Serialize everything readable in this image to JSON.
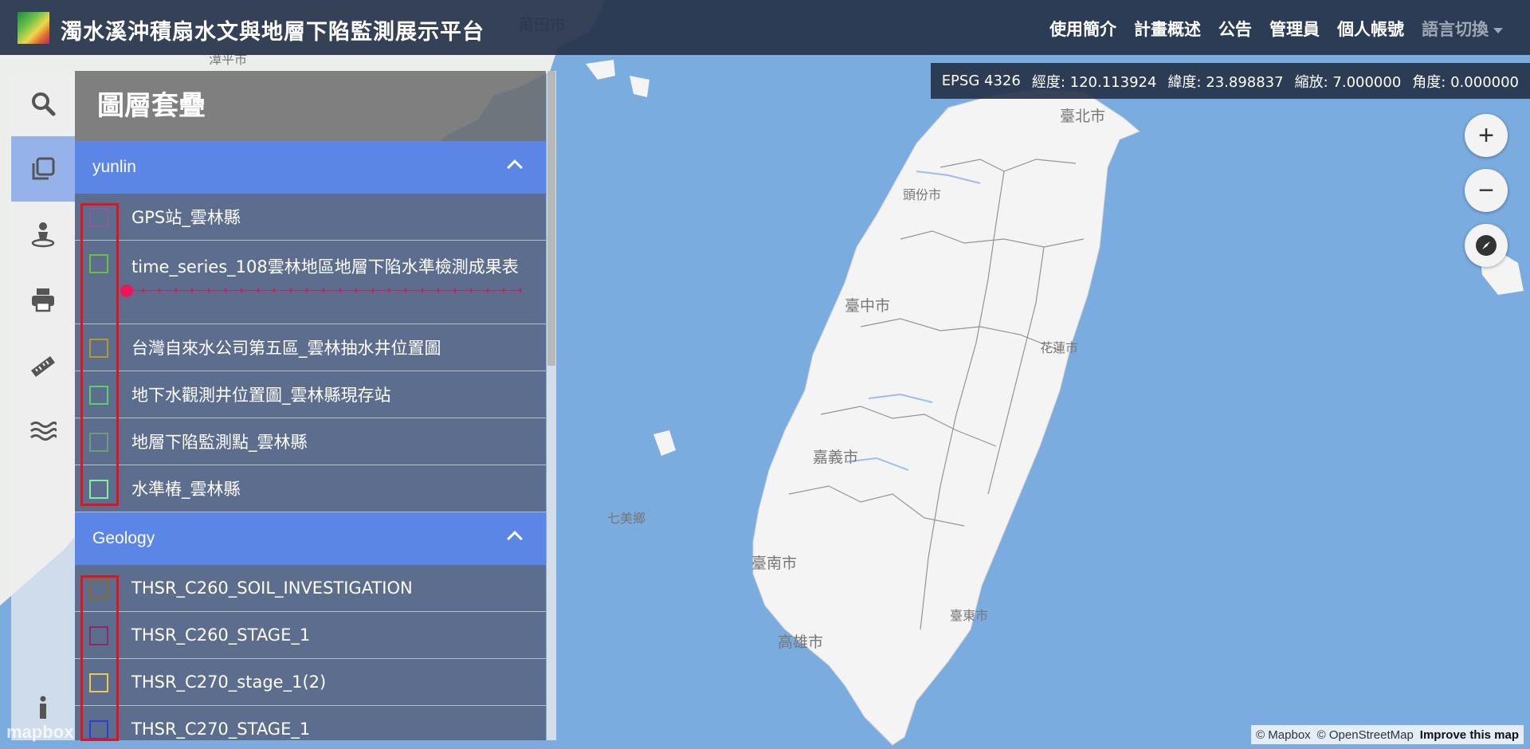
{
  "app": {
    "title": "濁水溪沖積扇水文與地層下陷監測展示平台"
  },
  "nav": {
    "items": [
      "使用簡介",
      "計畫概述",
      "公告",
      "管理員",
      "個人帳號"
    ],
    "language_label": "語言切換"
  },
  "coords": {
    "epsg": "EPSG 4326",
    "lon_label": "經度:",
    "lon": "120.113924",
    "lat_label": "緯度:",
    "lat": "23.898837",
    "zoom_label": "縮放:",
    "zoom": "7.000000",
    "angle_label": "角度:",
    "angle": "0.000000"
  },
  "map_controls": {
    "zoom_in": "+",
    "zoom_out": "−"
  },
  "map_labels": {
    "cities": [
      "臺北市",
      "臺中市",
      "嘉義市",
      "臺南市",
      "高雄市",
      "花蓮市",
      "臺東市",
      "頭份市",
      "七美鄉",
      "莆田市",
      "漳平市"
    ],
    "attribution_mapbox": "© Mapbox",
    "attribution_osm": "© OpenStreetMap",
    "attribution_improve": "Improve this map",
    "mapbox_logo": "mapbox"
  },
  "panel": {
    "title": "圖層套疊",
    "groups": [
      {
        "name": "yunlin",
        "layers": [
          {
            "label": "GPS站_雲林縣",
            "checkbox_color": "#8a5a9a"
          },
          {
            "label": "time_series_108雲林地區地層下陷水準檢測成果表",
            "checkbox_color": "#69c23a"
          },
          {
            "label": "台灣自來水公司第五區_雲林抽水井位置圖",
            "checkbox_color": "#b39a2c"
          },
          {
            "label": "地下水觀測井位置圖_雲林縣現存站",
            "checkbox_color": "#5ad16a"
          },
          {
            "label": "地層下陷監測點_雲林縣",
            "checkbox_color": "#6e9c7e"
          },
          {
            "label": "水準樁_雲林縣",
            "checkbox_color": "#7ff0a0"
          }
        ]
      },
      {
        "name": "Geology",
        "layers": [
          {
            "label": "THSR_C260_SOIL_INVESTIGATION",
            "checkbox_color": "#8a6a2a"
          },
          {
            "label": "THSR_C260_STAGE_1",
            "checkbox_color": "#8a2a6a"
          },
          {
            "label": "THSR_C270_stage_1(2)",
            "checkbox_color": "#f0c850"
          },
          {
            "label": "THSR_C270_STAGE_1",
            "checkbox_color": "#2a40d0"
          }
        ]
      }
    ]
  },
  "time_slider": {
    "position": 0.0
  },
  "colors": {
    "navbar": "#26344a",
    "group_header": "#5b86e6",
    "layer_row": "#5d6d8e",
    "highlight_outline": "#e0141e",
    "slider": "#f0155a",
    "sea": "#7aace0",
    "land": "#f4f4f4"
  },
  "rail_icons": [
    "search-icon",
    "layers-icon",
    "person-pin-icon",
    "print-icon",
    "ruler-icon",
    "water-icon",
    "info-icon"
  ]
}
